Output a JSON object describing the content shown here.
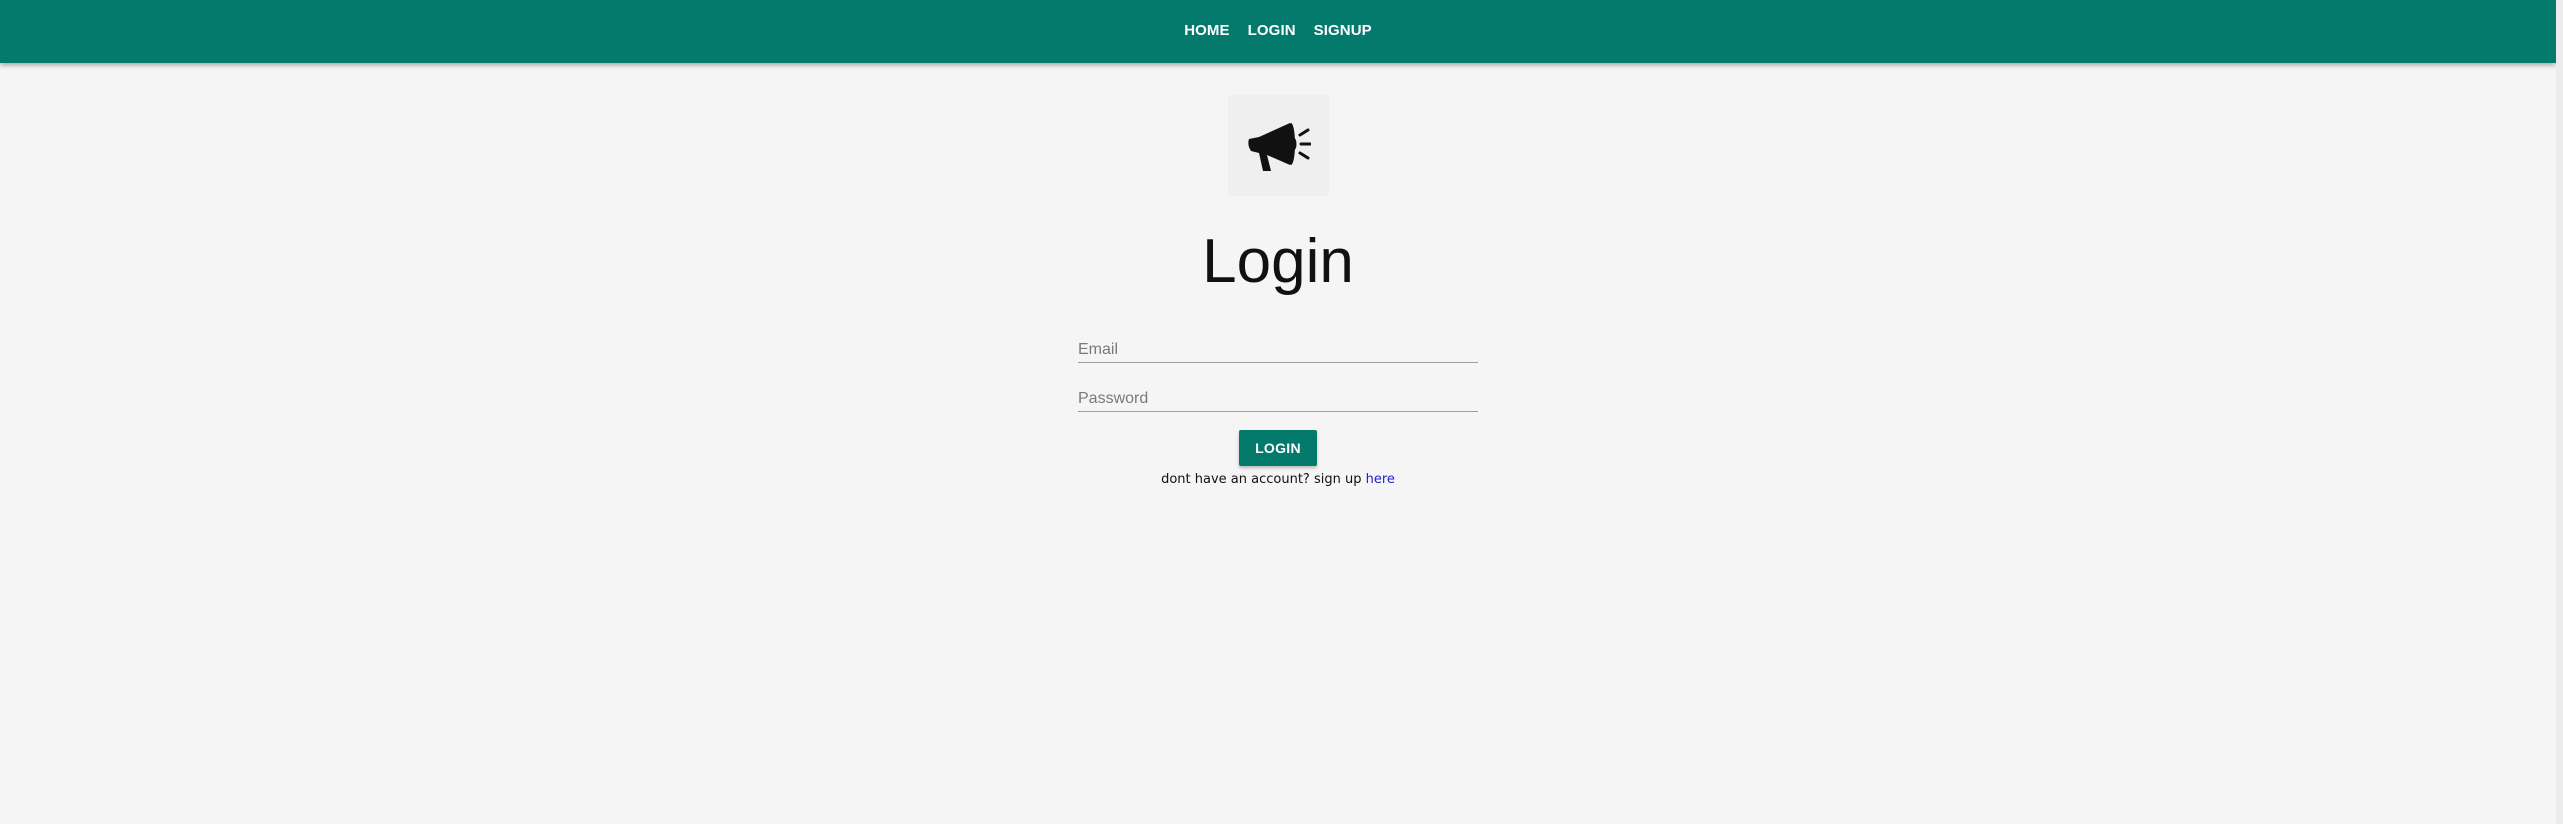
{
  "nav": {
    "links": [
      {
        "label": "HOME"
      },
      {
        "label": "LOGIN"
      },
      {
        "label": "SIGNUP"
      }
    ]
  },
  "logo": {
    "icon": "megaphone-icon"
  },
  "login_form": {
    "title": "Login",
    "email_placeholder": "Email",
    "email_value": "",
    "password_placeholder": "Password",
    "password_value": "",
    "submit_label": "LOGIN",
    "signup_prompt": "dont have an account? sign up ",
    "signup_link": "here"
  },
  "colors": {
    "primary": "#047a6d",
    "background": "#f5f5f5",
    "link": "#2020d0"
  }
}
